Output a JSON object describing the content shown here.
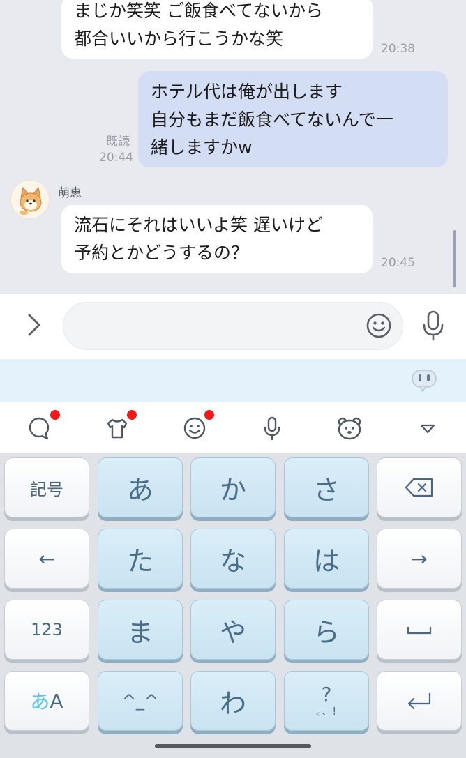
{
  "chat": {
    "messages": [
      {
        "direction": "in",
        "lines": [
          "まじか笑笑 ご飯食べてないから",
          "都合いいから行こうかな笑"
        ],
        "time": "20:38"
      },
      {
        "direction": "out",
        "lines": [
          "ホテル代は俺が出します",
          "自分もまだ飯食べてないんで一",
          "緒しますかw"
        ],
        "read": "既読",
        "time": "20:44"
      },
      {
        "direction": "in",
        "sender": "萌恵",
        "lines": [
          "流石にそれはいいよ笑 遅いけど",
          "予約とかどうするの？"
        ],
        "time": "20:45"
      }
    ]
  },
  "input_bar": {
    "placeholder": "",
    "icons": [
      "chevron-right-icon",
      "emoji-icon",
      "microphone-icon"
    ]
  },
  "suggestion_strip": {
    "icon": "bot-icon"
  },
  "keyboard_toolbar": {
    "items": [
      {
        "icon": "chat-bubble-icon",
        "notification": true
      },
      {
        "icon": "tshirt-icon",
        "notification": true
      },
      {
        "icon": "smiley-icon",
        "notification": true
      },
      {
        "icon": "microphone-icon",
        "notification": false
      },
      {
        "icon": "bear-face-icon",
        "notification": false
      },
      {
        "icon": "collapse-triangle-icon",
        "notification": false
      }
    ]
  },
  "keyboard": {
    "rows": [
      [
        "記号",
        "あ",
        "か",
        "さ",
        "delete"
      ],
      [
        "←",
        "た",
        "な",
        "は",
        "→"
      ],
      [
        "123",
        "ま",
        "や",
        "ら",
        "space"
      ],
      [
        "あA",
        "^_^",
        "わ",
        "?。、!",
        "enter"
      ]
    ],
    "labels": {
      "symbols": "記号",
      "a": "あ",
      "ka": "か",
      "sa": "さ",
      "left": "←",
      "ta": "た",
      "na": "な",
      "ha": "は",
      "right": "→",
      "num": "123",
      "ma": "ま",
      "ya": "や",
      "ra": "ら",
      "mode_a": "あ",
      "mode_A": "A",
      "kaomoji": "^_^",
      "wa": "わ",
      "punct_q": "?",
      "punct_rest": "。、!"
    }
  },
  "colors": {
    "chat_bg": "#e8eaef",
    "incoming_bubble": "#ffffff",
    "outgoing_bubble": "#d3ddf4",
    "key_main": "#cfe7f3",
    "notification_dot": "#f01818",
    "mode_accent": "#4ec6f0"
  }
}
